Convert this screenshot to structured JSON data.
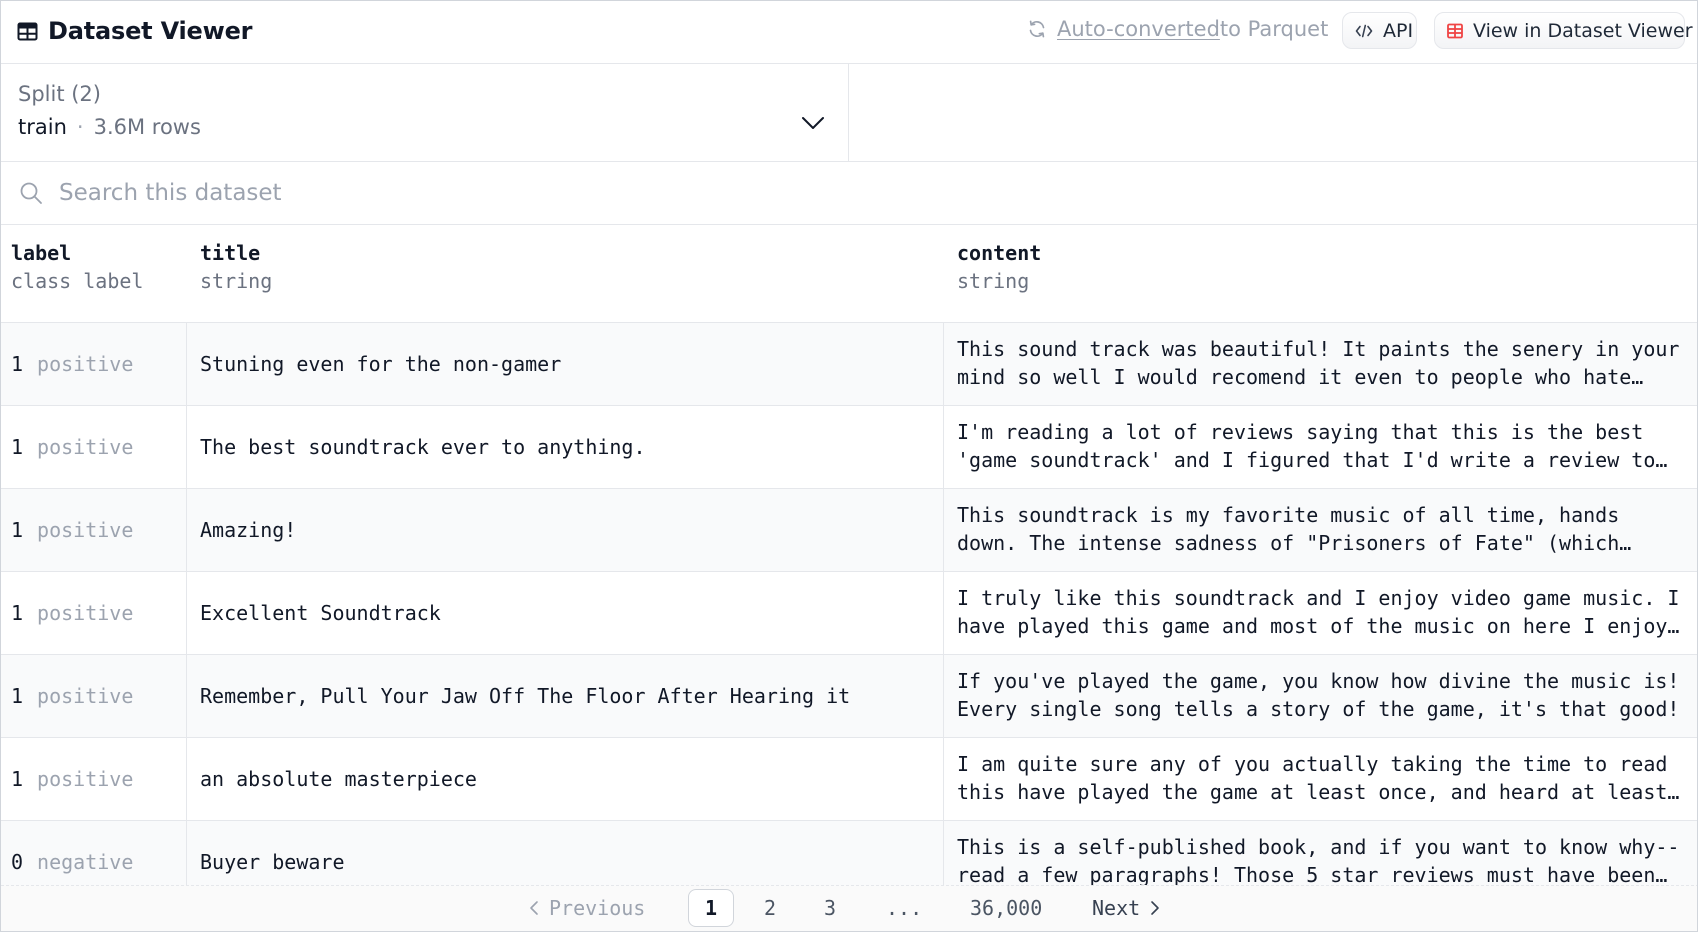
{
  "header": {
    "title": "Dataset Viewer",
    "parquet_link": "Auto-converted",
    "parquet_rest": " to Parquet",
    "api_label": "API",
    "view_label": "View in Dataset Viewer"
  },
  "split": {
    "label": "Split (2)",
    "name": "train",
    "separator": "·",
    "rows": "3.6M rows"
  },
  "search": {
    "placeholder": "Search this dataset",
    "value": ""
  },
  "columns": [
    {
      "name": "label",
      "type": "class label"
    },
    {
      "name": "title",
      "type": "string"
    },
    {
      "name": "content",
      "type": "string"
    }
  ],
  "rows": [
    {
      "label_num": "1",
      "label_name": "positive",
      "title": "Stuning even for the non-gamer",
      "content": "This sound track was beautiful! It paints the senery in your mind so well I would recomend it even to people who hate vid. game music! I have played the game Chrono Cross but out of all of the games I have ever played it has the best music!"
    },
    {
      "label_num": "1",
      "label_name": "positive",
      "title": "The best soundtrack ever to anything.",
      "content": "I'm reading a lot of reviews saying that this is the best 'game soundtrack' and I figured that I'd write a review to disagree a bit."
    },
    {
      "label_num": "1",
      "label_name": "positive",
      "title": "Amazing!",
      "content": "This soundtrack is my favorite music of all time, hands down. The intense sadness of \"Prisoners of Fate\" (which means all the more if you've played the game) and the hope in \"A Distant Promise\" and \"Girl who Stole the Star\" have been an important inspiration to me personally."
    },
    {
      "label_num": "1",
      "label_name": "positive",
      "title": "Excellent Soundtrack",
      "content": "I truly like this soundtrack and I enjoy video game music. I have played this game and most of the music on here I enjoy and it's truly relaxing and peaceful."
    },
    {
      "label_num": "1",
      "label_name": "positive",
      "title": "Remember, Pull Your Jaw Off The Floor After Hearing it",
      "content": "If you've played the game, you know how divine the music is! Every single song tells a story of the game, it's that good!"
    },
    {
      "label_num": "1",
      "label_name": "positive",
      "title": "an absolute masterpiece",
      "content": "I am quite sure any of you actually taking the time to read this have played the game at least once, and heard at least a few of the tracks here."
    },
    {
      "label_num": "0",
      "label_name": "negative",
      "title": "Buyer beware",
      "content": "This is a self-published book, and if you want to know why--read a few paragraphs! Those 5 star reviews must have been written by Ms. Haddon's family and friends--or perhaps, by herself!"
    }
  ],
  "pagination": {
    "previous": "Previous",
    "pages": [
      "1",
      "2",
      "3"
    ],
    "ellipsis": "...",
    "last": "36,000",
    "next": "Next",
    "current": "1"
  }
}
